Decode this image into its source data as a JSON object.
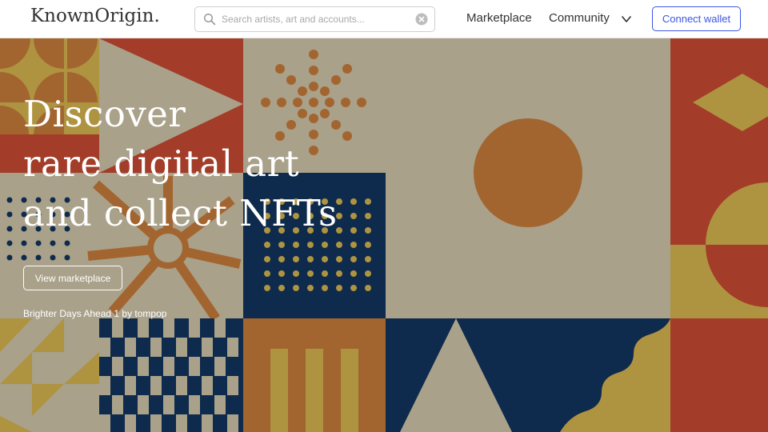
{
  "header": {
    "logo": "KnownOrigin.",
    "search_placeholder": "Search artists, art and accounts...",
    "nav": {
      "marketplace": "Marketplace",
      "community": "Community"
    },
    "connect_wallet": "Connect wallet"
  },
  "hero": {
    "title_lines": [
      "Discover",
      "rare digital art",
      "and collect NFTs"
    ],
    "cta": "View marketplace",
    "credit": "Brighter Days Ahead 1 by tompop"
  },
  "colors": {
    "red": "#a33c28",
    "mustard": "#ae9340",
    "beige": "#a9a18a",
    "navy": "#0e2a4c",
    "orange": "#a3652f",
    "accent_blue": "#3b55e6"
  }
}
